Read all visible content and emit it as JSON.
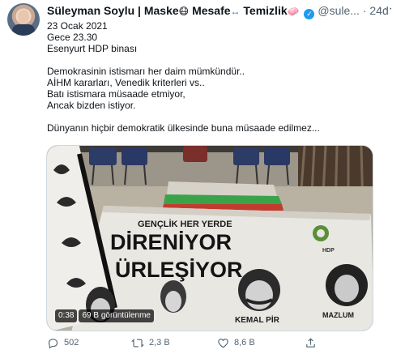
{
  "author": {
    "name": "Süleyman Soylu | Maske",
    "mask_emoji": "😷",
    "mesafe_label": "Mesafe",
    "mesafe_emoji": "↔",
    "temizlik_label": "Temizlik",
    "temizlik_emoji": "🧼",
    "verified_glyph": "✓",
    "handle": "@sule...",
    "separator": "·",
    "age": "24d"
  },
  "more_glyph": "···",
  "body_lines": [
    "23 Ocak 2021",
    "Gece 23.30",
    "Esenyurt HDP binası",
    "",
    "Demokrasinin istismarı her daim mümkündür..",
    "AİHM kararları, Venedik kriterleri vs..",
    "Batı istismara müsaade etmiyor,",
    "Ancak bizden istiyor.",
    "",
    "Dünyanın hiçbir demokratik ülkesinde buna müsaade edilmez..."
  ],
  "video": {
    "duration": "0:38",
    "views": "69 B görüntülenme",
    "banner_line1": "GENÇLİK HER YERDE",
    "banner_line2": "DİRENİYOR",
    "banner_line3": "ÜRLEŞİYOR",
    "banner_small": "HDP",
    "banner_name": "KEMAL PİR",
    "banner_name2": "MAZLUM"
  },
  "actions": {
    "reply_count": "502",
    "retweet_count": "2,3 B",
    "like_count": "8,6 B"
  },
  "colors": {
    "like_red": "#e0245e",
    "icon_gray": "#536471",
    "verified_blue": "#1d9bf0"
  }
}
